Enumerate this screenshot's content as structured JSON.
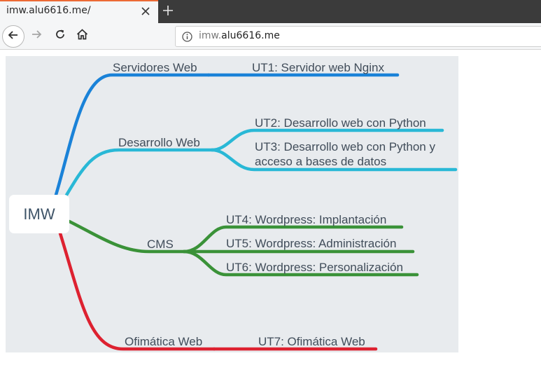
{
  "tab": {
    "title": "imw.alu6616.me/"
  },
  "icons": {
    "tab_close": "close-icon",
    "new_tab": "plus-icon",
    "back": "arrow-left-icon",
    "forward": "arrow-right-icon",
    "reload": "reload-icon",
    "home": "home-icon",
    "site_info": "info-icon"
  },
  "address": {
    "prefix": "imw.",
    "host": "alu6616.me"
  },
  "colors": {
    "tab_accent": "#ec6a35",
    "canvas_bg": "#e8ebee",
    "branch_blue": "#1a82d8",
    "branch_cyan": "#29b8d6",
    "branch_green": "#3a9238",
    "branch_red": "#dd2130"
  },
  "mindmap": {
    "root": "IMW",
    "branches": [
      {
        "label": "Servidores Web",
        "topics": [
          "UT1: Servidor web Nginx"
        ]
      },
      {
        "label": "Desarrollo Web",
        "topics": [
          "UT2: Desarrollo web con Python",
          "UT3: Desarrollo web con Python y acceso a bases de datos"
        ]
      },
      {
        "label": "CMS",
        "topics": [
          "UT4: Wordpress: Implantación",
          "UT5: Wordpress: Administración",
          "UT6: Wordpress: Personalización"
        ]
      },
      {
        "label": "Ofimática Web",
        "topics": [
          "UT7: Ofimática Web"
        ]
      }
    ]
  }
}
